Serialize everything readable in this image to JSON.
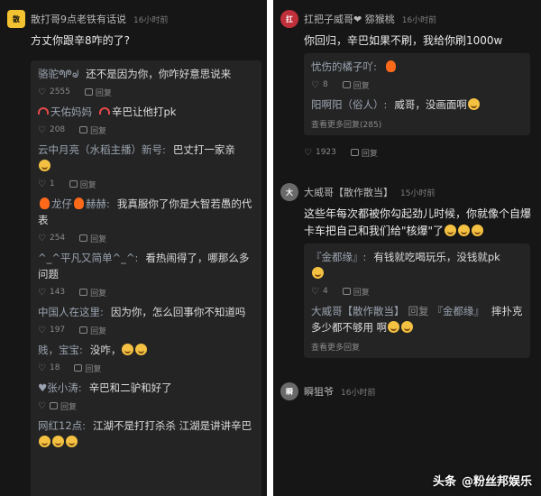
{
  "left": {
    "post": {
      "author": "散打哥9点老铁有话说",
      "time": "16小时前",
      "text": "方丈你跟辛8咋的了?"
    },
    "replies": [
      {
        "author": "骆驼ᖗᖘᖙ",
        "text": "还不是因为你，你咋好意思说来",
        "likes": "2555",
        "reply_label": "回复"
      },
      {
        "author": "天佑妈妈",
        "text": "辛巴让他打pk",
        "likes": "208",
        "reply_label": "回复"
      },
      {
        "author": "云中月亮（水稻主播）新号:",
        "text": "巴丈打一家亲",
        "likes": "1",
        "reply_label": "回复"
      },
      {
        "author": "龙仔",
        "author2": "赫赫:",
        "text": "我真服你了你是大智若愚的代表",
        "likes": "254",
        "reply_label": "回复"
      },
      {
        "author": "^_^平凡又简单^_^:",
        "text": "看热闹得了，哪那么多问题",
        "likes": "143",
        "reply_label": "回复"
      },
      {
        "author": "中国人在这里:",
        "text": "因为你，怎么回事你不知道吗",
        "likes": "197",
        "reply_label": "回复"
      },
      {
        "author": "贱，宝宝:",
        "text": "没咋，",
        "likes": "18",
        "reply_label": "回复"
      },
      {
        "author": "♥张小涛:",
        "text": "辛巴和二驴和好了",
        "likes": "",
        "reply_label": "回复"
      },
      {
        "author": "网红12点:",
        "text": "江湖不是打打杀杀 江湖是讲讲辛巴",
        "likes": "",
        "reply_label": ""
      }
    ]
  },
  "right": {
    "post1": {
      "author": "扛把子威哥❤ 猕猴桃",
      "time": "16小时前",
      "text": "你回归，辛巴如果不刷，我给你刷1000w",
      "replies": [
        {
          "author": "忧伤的橘子吖:",
          "text": "",
          "likes": "8",
          "reply_label": "回复"
        },
        {
          "author": "阳啊阳（俗人）:",
          "text": "威哥，没画面啊",
          "likes": "",
          "reply_label": ""
        }
      ],
      "more": "查看更多回复(285)",
      "likes": "1923",
      "reply_label": "回复"
    },
    "post2": {
      "author": "大威哥【散作散当】",
      "time": "15小时前",
      "text": "这些年每次都被你勾起劲儿时候，你就像个自爆卡车把自己和我们给\"核爆\"了",
      "replies": [
        {
          "author": "『金都缘』:",
          "text": "有钱就吃喝玩乐，没钱就pk",
          "likes": "4",
          "reply_label": "回复"
        },
        {
          "author": "大威哥【散作散当】",
          "author_mid": "回复",
          "author2": "『金都缘』",
          "text": "摔扑克多少都不够用 啊",
          "likes": "",
          "reply_label": ""
        }
      ],
      "more": "查看更多回复"
    },
    "post3": {
      "author": "瞬狙爷",
      "time": "16小时前"
    }
  },
  "watermark": {
    "brand": "头条",
    "account": "@粉丝邦娱乐"
  },
  "colors": {
    "background": "#161616",
    "reply_box": "#242424",
    "avatar_yellow": "#f2c230"
  }
}
